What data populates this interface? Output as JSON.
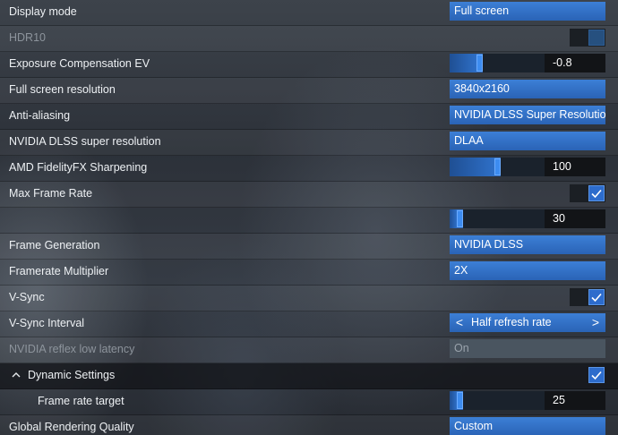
{
  "settings": {
    "display_mode": {
      "label": "Display mode",
      "value": "Full screen"
    },
    "hdr10": {
      "label": "HDR10",
      "checked": false
    },
    "exposure": {
      "label": "Exposure Compensation EV",
      "value": "-0.8",
      "level": 0.3
    },
    "resolution": {
      "label": "Full screen resolution",
      "value": "3840x2160"
    },
    "anti_aliasing": {
      "label": "Anti-aliasing",
      "value": "NVIDIA DLSS Super Resolution"
    },
    "dlss_sr": {
      "label": "NVIDIA DLSS super resolution",
      "value": "DLAA"
    },
    "amd_sharpening": {
      "label": "AMD FidelityFX Sharpening",
      "value": "100",
      "level": 0.5
    },
    "max_frame_rate": {
      "label": "Max Frame Rate",
      "checked": true,
      "value": "30",
      "level": 0.08
    },
    "frame_generation": {
      "label": "Frame Generation",
      "value": "NVIDIA DLSS"
    },
    "framerate_multiplier": {
      "label": "Framerate Multiplier",
      "value": "2X"
    },
    "vsync": {
      "label": "V-Sync",
      "checked": true
    },
    "vsync_interval": {
      "label": "V-Sync Interval",
      "value": "Half refresh rate",
      "left_arrow": "<",
      "right_arrow": ">"
    },
    "reflex": {
      "label": "NVIDIA reflex low latency",
      "value": "On"
    },
    "dynamic_settings": {
      "label": "Dynamic Settings",
      "checked": true
    },
    "frame_rate_target": {
      "label": "Frame rate target",
      "value": "25",
      "level": 0.08
    },
    "global_quality": {
      "label": "Global Rendering Quality",
      "value": "Custom"
    }
  },
  "colors": {
    "accent": "#2e6fc7",
    "dark_field": "#121417"
  }
}
